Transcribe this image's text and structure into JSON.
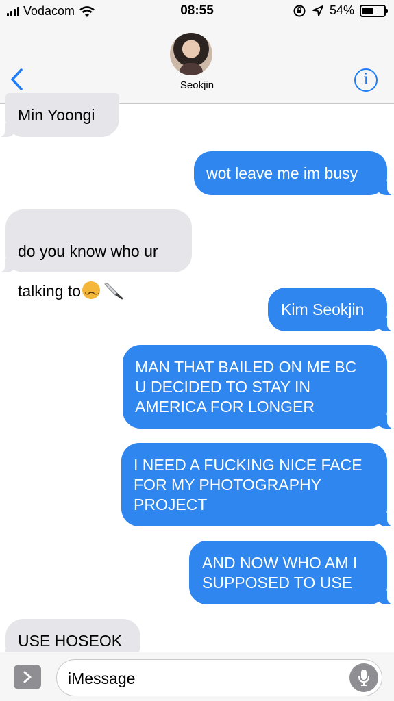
{
  "status_bar": {
    "carrier": "Vodacom",
    "time": "08:55",
    "battery_percent": "54%",
    "battery_level": 0.54,
    "icons": [
      "signal-icon",
      "wifi-icon",
      "rotation-lock-icon",
      "location-arrow-icon",
      "battery-icon"
    ]
  },
  "conversation": {
    "contact_name": "Seokjin",
    "back_icon": "chevron-left-icon",
    "info_icon": "info-icon",
    "info_label": "i"
  },
  "messages": [
    {
      "direction": "received",
      "text": "Min Yoongi"
    },
    {
      "direction": "sent",
      "text": "wot leave me im busy"
    },
    {
      "direction": "received",
      "text_line1": "do you know who ur",
      "text_line2": "talking to",
      "emojis": [
        "upside-down-face",
        "knife"
      ]
    },
    {
      "direction": "sent",
      "text": "Kim Seokjin"
    },
    {
      "direction": "sent",
      "text": "MAN THAT BAILED ON ME BC\nU DECIDED TO STAY IN\nAMERICA FOR LONGER"
    },
    {
      "direction": "sent",
      "text": "I NEED A FUCKING NICE FACE\nFOR MY PHOTOGRAPHY\nPROJECT"
    },
    {
      "direction": "sent",
      "text": "AND NOW WHO AM I\nSUPPOSED TO USE"
    },
    {
      "direction": "received",
      "text": "USE HOSEOK"
    }
  ],
  "input_bar": {
    "placeholder": "iMessage",
    "apps_icon": "chevron-right-icon",
    "mic_icon": "microphone-icon"
  },
  "colors": {
    "sent_bubble": "#2f86ef",
    "received_bubble": "#e5e5ea",
    "accent": "#1f7ef5"
  }
}
